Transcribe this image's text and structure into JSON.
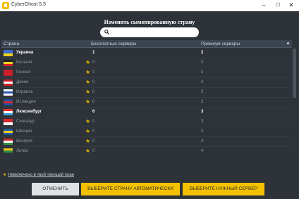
{
  "window": {
    "title": "CyberGhost 5.5",
    "min_glyph": "–",
    "max_glyph": "☐",
    "close_glyph": "✕"
  },
  "dialog": {
    "heading": "Изменить сымитированную страну",
    "search": {
      "value": "",
      "placeholder": ""
    }
  },
  "table": {
    "columns": {
      "country": "Страна",
      "free": "Бесплатные серверы",
      "premium": "Премиум серверы"
    },
    "sort_glyph": "▲",
    "rows": [
      {
        "name": "Украина",
        "free": "1",
        "premium": "2",
        "premium_only": false,
        "highlighted": true,
        "flag": [
          "#3a6fd1",
          "#f3d21c"
        ]
      },
      {
        "name": "Бельгия",
        "free": "0",
        "premium": "3",
        "premium_only": true,
        "highlighted": false,
        "flag": [
          "#222222",
          "#f2d31c",
          "#d2272c"
        ]
      },
      {
        "name": "Гонконг",
        "free": "0",
        "premium": "3",
        "premium_only": true,
        "highlighted": false,
        "flag": [
          "#c8202a",
          "#c8202a"
        ]
      },
      {
        "name": "Дания",
        "free": "0",
        "premium": "3",
        "premium_only": true,
        "highlighted": false,
        "flag": [
          "#c8202a",
          "#ffffff",
          "#c8202a"
        ]
      },
      {
        "name": "Израиль",
        "free": "0",
        "premium": "3",
        "premium_only": true,
        "highlighted": false,
        "flag": [
          "#ffffff",
          "#2457b6",
          "#ffffff"
        ]
      },
      {
        "name": "Исландия",
        "free": "0",
        "premium": "3",
        "premium_only": true,
        "highlighted": false,
        "flag": [
          "#1e4fa0",
          "#d02a2a",
          "#1e4fa0"
        ]
      },
      {
        "name": "Люксембург",
        "free": "6",
        "premium": "3",
        "premium_only": false,
        "highlighted": true,
        "flag": [
          "#e2352c",
          "#ffffff",
          "#3aa0d6"
        ]
      },
      {
        "name": "Сингапур",
        "free": "0",
        "premium": "3",
        "premium_only": true,
        "highlighted": false,
        "flag": [
          "#d3272c",
          "#ffffff"
        ]
      },
      {
        "name": "Швеция",
        "free": "0",
        "premium": "3",
        "premium_only": true,
        "highlighted": false,
        "flag": [
          "#1f5aa5",
          "#f1cd1c",
          "#1f5aa5"
        ]
      },
      {
        "name": "Венгрия",
        "free": "0",
        "premium": "4",
        "premium_only": true,
        "highlighted": false,
        "flag": [
          "#d2272c",
          "#ffffff",
          "#3b8e45"
        ]
      },
      {
        "name": "Литва",
        "free": "0",
        "premium": "4",
        "premium_only": true,
        "highlighted": false,
        "flag": [
          "#f2c51c",
          "#2f8a44",
          "#c8202a"
        ]
      }
    ]
  },
  "footnote": {
    "star_glyph": "★",
    "text": "Невключено в твой текущий план"
  },
  "buttons": {
    "cancel": "ОТМЕНИТЬ",
    "auto": "ВЫБЕРИТЕ СТРАНУ АВТОМАТИЧЕСКИ",
    "manual": "ВЫБЕРИТЕ НУЖНЫЙ СЕРВЕР"
  },
  "colors": {
    "background": "#2e3339",
    "accent": "#f3c100",
    "star": "#e8b800"
  }
}
